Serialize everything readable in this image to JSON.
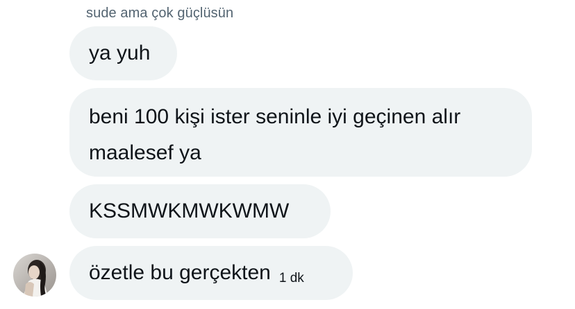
{
  "conversation": {
    "sender_name": "sude ama çok güçlüsün",
    "messages": [
      {
        "text": "ya yuh"
      },
      {
        "text": "beni 100 kişi ister seninle iyi geçinen alır maalesef ya"
      },
      {
        "text": "KSSMWKMWKWMW"
      },
      {
        "text": "özetle bu gerçekten",
        "timestamp": "1 dk"
      }
    ]
  },
  "colors": {
    "bubble_background": "#eff3f4",
    "text_primary": "#0f1419",
    "text_secondary": "#536471"
  }
}
